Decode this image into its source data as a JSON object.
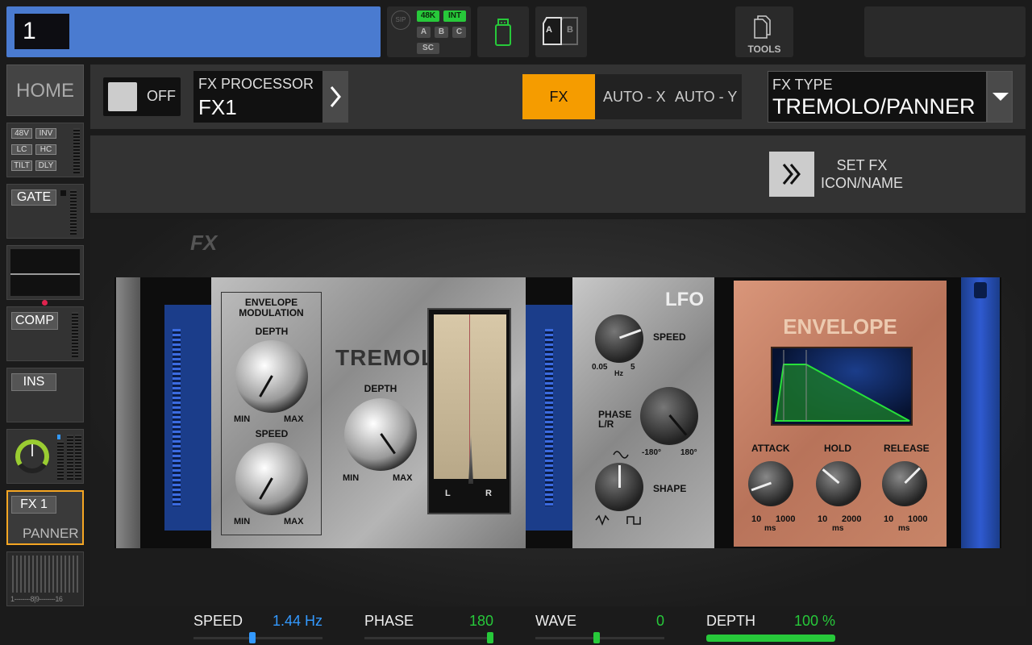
{
  "channel": {
    "number": "1"
  },
  "status": {
    "sip": "SIP",
    "rate": "48K",
    "clock": "INT",
    "a": "A",
    "b": "B",
    "c": "C",
    "sc": "SC"
  },
  "ab": {
    "a": "A",
    "b": "B"
  },
  "tools": {
    "label": "TOOLS"
  },
  "sidebar": {
    "home": "HOME",
    "preamp": {
      "tags": [
        "48V",
        "INV",
        "LC",
        "HC",
        "TILT",
        "DLY"
      ]
    },
    "gate": "GATE",
    "comp": "COMP",
    "ins": "INS",
    "fx": {
      "name": "FX 1",
      "type": "PANNER"
    },
    "bus_scale": [
      "1",
      "8",
      "9",
      "16"
    ]
  },
  "header": {
    "toggle_label": "OFF",
    "processor_label": "FX PROCESSOR",
    "processor_value": "FX1",
    "modes": [
      "FX",
      "AUTO - X",
      "AUTO - Y"
    ],
    "fx_type_label": "FX TYPE",
    "fx_type_value": "TREMOLO/PANNER",
    "set_fx_line1": "SET FX",
    "set_fx_line2": "ICON/NAME"
  },
  "rack": {
    "logo": "FX",
    "env_mod_title": "ENVELOPE MODULATION",
    "depth": "DEPTH",
    "speed": "SPEED",
    "min": "MIN",
    "max": "MAX",
    "tremolo": "TREMOLO",
    "meter_l": "L",
    "meter_r": "R",
    "lfo": "LFO",
    "lfo_speed": "SPEED",
    "lfo_speed_min": "0.05",
    "lfo_speed_unit": "Hz",
    "lfo_speed_max": "5",
    "phase": "PHASE",
    "phase_lr": "L/R",
    "phase_min": "-180°",
    "phase_max": "180°",
    "shape": "SHAPE",
    "envelope": "ENVELOPE",
    "attack": "ATTACK",
    "hold": "HOLD",
    "release": "RELEASE",
    "attack_range": [
      "10",
      "1000"
    ],
    "hold_range": [
      "10",
      "2000"
    ],
    "release_range": [
      "10",
      "1000"
    ],
    "ms": "ms"
  },
  "params": [
    {
      "label": "SPEED",
      "value": "1.44 Hz",
      "color": "#3399ff",
      "fraction": 0.48
    },
    {
      "label": "PHASE",
      "value": "180",
      "color": "#27c93a",
      "fraction": 1.0
    },
    {
      "label": "WAVE",
      "value": "0",
      "color": "#27c93a",
      "fraction": 0.5
    },
    {
      "label": "DEPTH",
      "value": "100 %",
      "color": "#27c93a",
      "fraction": 1.0
    }
  ]
}
